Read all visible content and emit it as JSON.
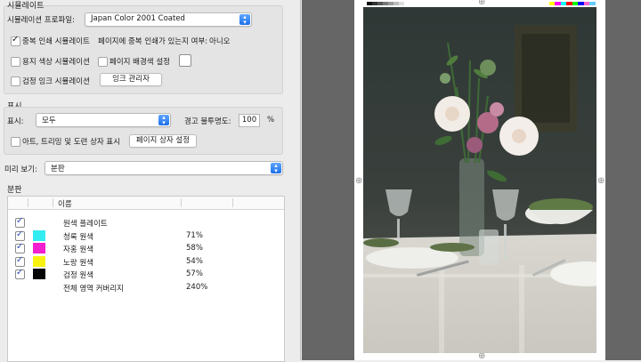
{
  "simulation": {
    "title": "시뮬레이트",
    "profile_label": "시뮬레이션 프로파일:",
    "profile_value": "Japan Color 2001 Coated",
    "overprint_label": "중복 인쇄 시뮬레이트",
    "overprint_checked": true,
    "page_overprint_label": "페이지에 중복 인쇄가 있는지 여부:",
    "page_overprint_value": "아니오",
    "paper_color_label": "용지 색상 시뮬레이션",
    "page_bg_label": "페이지 배경색 설정",
    "black_ink_label": "검정 잉크 시뮬레이션",
    "ink_manager_button": "잉크 관리자"
  },
  "display": {
    "title": "표시",
    "show_label": "표시:",
    "show_value": "모두",
    "warning_label": "경고 불투명도:",
    "warning_value": "100",
    "warning_unit": "%",
    "art_trim_label": "아트, 트리밍 및 도련 상자 표시",
    "page_box_button": "페이지 상자 설정"
  },
  "preview": {
    "label": "미리 보기:",
    "value": "분판"
  },
  "separations": {
    "title": "분판",
    "column_name": "이름",
    "rows": [
      {
        "name": "원색 플레이트",
        "pct": "",
        "color": "",
        "checked": true
      },
      {
        "name": "청록 원색",
        "pct": "71%",
        "color": "#33ecf2",
        "checked": true
      },
      {
        "name": "자홍 원색",
        "pct": "58%",
        "color": "#f21ecf",
        "checked": true
      },
      {
        "name": "노랑 원색",
        "pct": "54%",
        "color": "#f8f20f",
        "checked": true
      },
      {
        "name": "검정 원색",
        "pct": "57%",
        "color": "#050505",
        "checked": true
      },
      {
        "name": "전체 영역 커버리지",
        "pct": "240%",
        "color": "",
        "checked": false
      }
    ]
  },
  "colors": {
    "accent": "#1d6fe8",
    "panel_bg": "#ececec",
    "canvas_bg": "#666666"
  }
}
